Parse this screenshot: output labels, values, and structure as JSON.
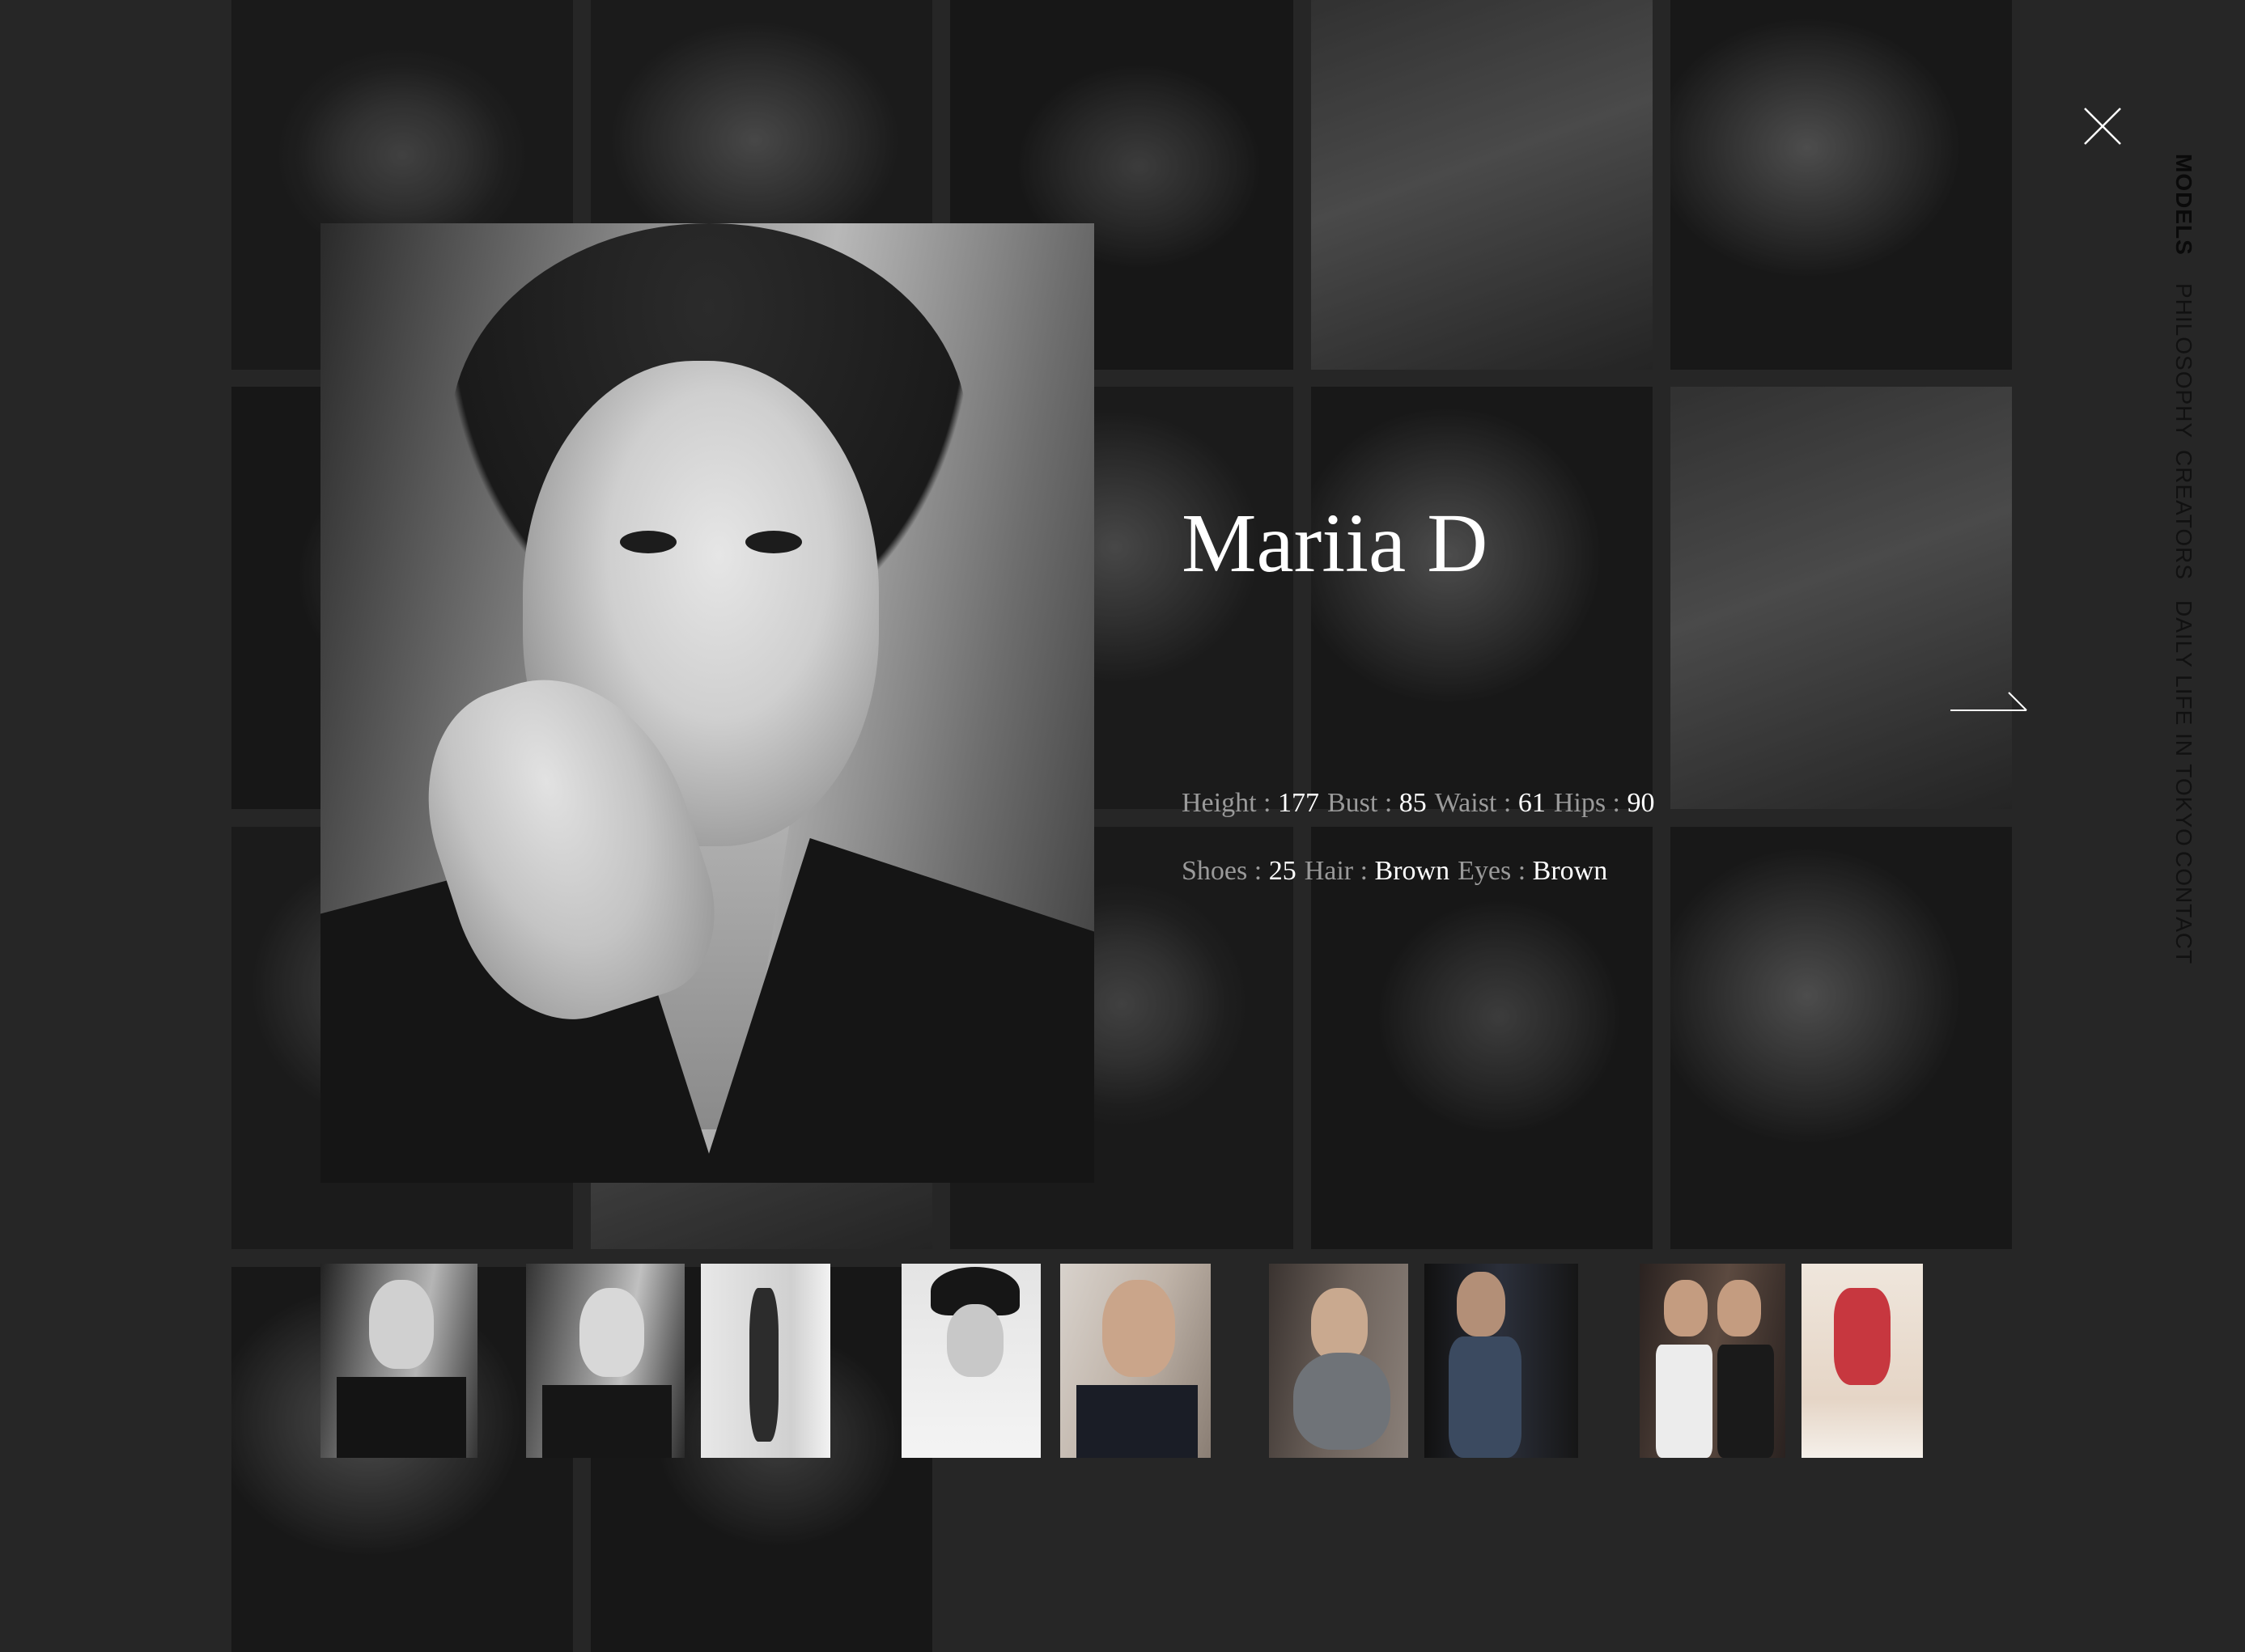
{
  "model": {
    "name": "Mariia D",
    "stats_row1": [
      {
        "label": "Height : ",
        "value": "177"
      },
      {
        "label": "Bust : ",
        "value": "85"
      },
      {
        "label": "Waist : ",
        "value": "61"
      },
      {
        "label": "Hips : ",
        "value": "90"
      }
    ],
    "stats_row2": [
      {
        "label": "Shoes : ",
        "value": "25"
      },
      {
        "label": "Hair : ",
        "value": "Brown"
      },
      {
        "label": "Eyes : ",
        "value": "Brown"
      }
    ]
  },
  "nav": {
    "items": [
      {
        "label": "MODELS",
        "active": true
      },
      {
        "label": "PHILOSOPHY",
        "active": false
      },
      {
        "label": "CREATORS",
        "active": false
      },
      {
        "label": "DAILY LIFE IN TOKYO",
        "active": false
      },
      {
        "label": "CONTACT",
        "active": false
      }
    ]
  },
  "icons": {
    "close": "close-icon",
    "next": "arrow-right-icon"
  },
  "colors": {
    "background": "#262626",
    "name_text": "#ffffff",
    "stat_label": "#9a9a9a",
    "stat_value": "#ffffff",
    "nav_text": "#111111"
  }
}
